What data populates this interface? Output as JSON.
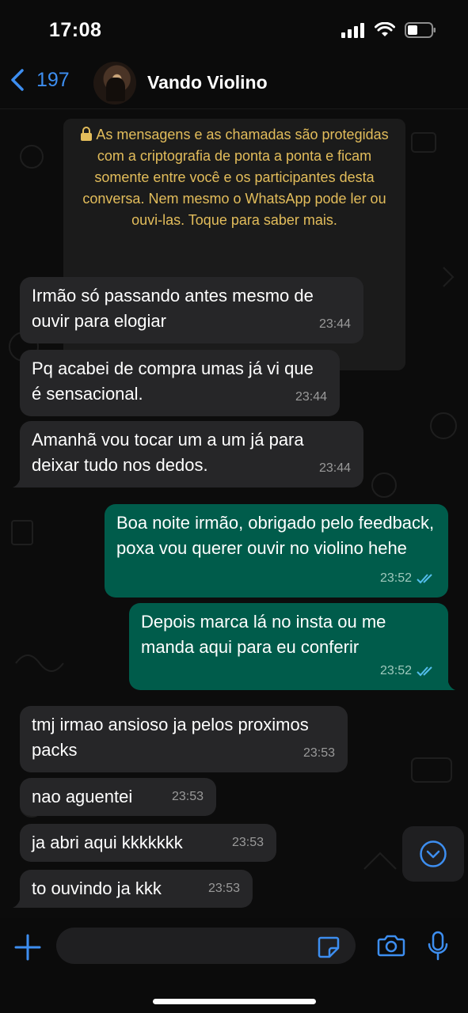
{
  "status": {
    "time": "17:08"
  },
  "header": {
    "back_count": "197",
    "contact_name": "Vando Violino"
  },
  "encryption_notice": "As mensagens e as chamadas são protegidas com a criptografia de ponta a ponta e ficam somente entre você e os participantes desta conversa. Nem mesmo o WhatsApp pode ler ou ouvi-las. Toque para saber mais.",
  "messages": [
    {
      "direction": "in",
      "text": "Irmão só passando antes mesmo de ouvir para elogiar",
      "time": "23:44"
    },
    {
      "direction": "in",
      "text": "Pq acabei de compra umas já vi que é sensacional.",
      "time": "23:44"
    },
    {
      "direction": "in",
      "text": "Amanhã vou tocar um a um já para deixar tudo nos dedos.",
      "time": "23:44"
    },
    {
      "direction": "out",
      "text": "Boa noite irmão, obrigado pelo feedback, poxa vou querer ouvir no violino hehe",
      "time": "23:52",
      "status": "read"
    },
    {
      "direction": "out",
      "text": "Depois marca lá no insta ou me manda aqui para eu conferir",
      "time": "23:52",
      "status": "read"
    },
    {
      "direction": "in",
      "text": "tmj irmao ansioso ja pelos proximos packs",
      "time": "23:53"
    },
    {
      "direction": "in",
      "text": "nao aguentei",
      "time": "23:53"
    },
    {
      "direction": "in",
      "text": "ja abri aqui kkkkkkk",
      "time": "23:53"
    },
    {
      "direction": "in",
      "text": "to ouvindo ja kkk",
      "time": "23:53"
    }
  ],
  "input": {
    "placeholder": ""
  },
  "colors": {
    "accent": "#3d8ef0",
    "outgoing": "#005c4b",
    "incoming": "#262628",
    "notice_text": "#e3bd5b",
    "read_ticks": "#53bdeb"
  }
}
